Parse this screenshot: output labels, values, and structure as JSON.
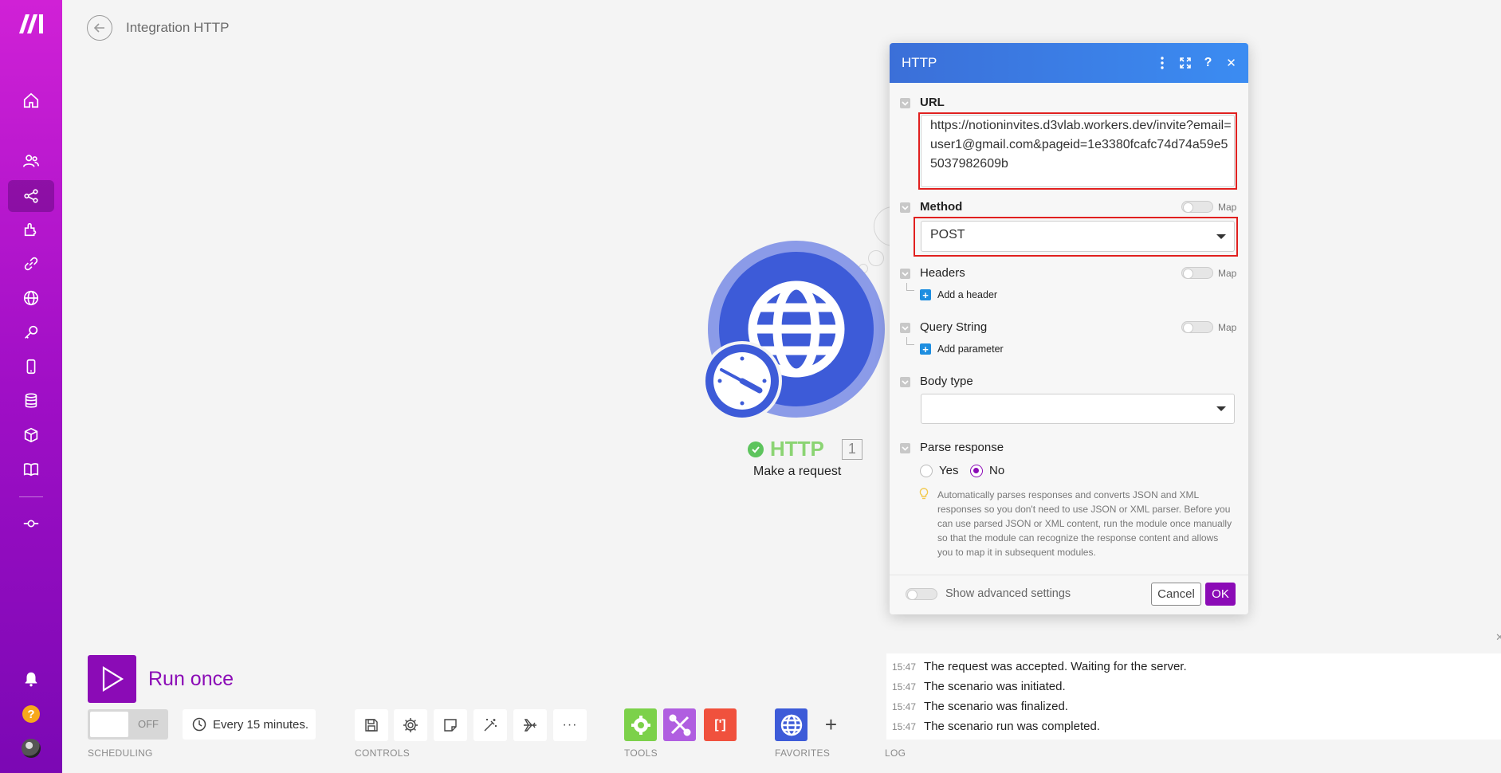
{
  "header": {
    "title": "Integration HTTP"
  },
  "sidebar": {
    "icons": [
      "logo-icon",
      "home-icon",
      "team-icon",
      "scenarios-icon",
      "apps-icon",
      "connections-icon",
      "webhooks-icon",
      "keys-icon",
      "devices-icon",
      "datastores-icon",
      "datastructures-icon",
      "docs-icon",
      "flow-icon",
      "notifications-icon",
      "help-icon",
      "avatar"
    ],
    "active": "scenarios-icon"
  },
  "module": {
    "name": "HTTP",
    "index": "1",
    "subtitle": "Make a request",
    "color": "#3d5bd8"
  },
  "bottom": {
    "run_label": "Run once",
    "toggle_text": "OFF",
    "schedule": "Every 15 minutes.",
    "sections": {
      "scheduling": "SCHEDULING",
      "controls": "CONTROLS",
      "tools": "TOOLS",
      "favorites": "FAVORITES",
      "log": "LOG"
    }
  },
  "log": [
    {
      "time": "15:47",
      "message": "The request was accepted. Waiting for the server."
    },
    {
      "time": "15:47",
      "message": "The scenario was initiated."
    },
    {
      "time": "15:47",
      "message": "The scenario was finalized."
    },
    {
      "time": "15:47",
      "message": "The scenario run was completed."
    }
  ],
  "dialog": {
    "title": "HTTP",
    "url": {
      "label": "URL",
      "value": "https://notioninvites.d3vlab.workers.dev/invite?email=user1@gmail.com&pageid=1e3380fcafc74d74a59e55037982609b"
    },
    "method": {
      "label": "Method",
      "value": "POST",
      "map": "Map"
    },
    "headers": {
      "label": "Headers",
      "add": "Add a header",
      "map": "Map"
    },
    "query": {
      "label": "Query String",
      "add": "Add parameter",
      "map": "Map"
    },
    "body": {
      "label": "Body type",
      "value": ""
    },
    "parse": {
      "label": "Parse response",
      "yes": "Yes",
      "no": "No",
      "selected": "No",
      "hint": "Automatically parses responses and converts JSON and XML responses so you don't need to use JSON or XML parser. Before you can use parsed JSON or XML content, run the module once manually so that the module can recognize the response content and allows you to map it in subsequent modules."
    },
    "advanced": "Show advanced settings",
    "cancel": "Cancel",
    "ok": "OK"
  },
  "colors": {
    "accent": "#8b0bb6",
    "dialog_header": "#3b7ae8",
    "highlight": "#e1201f"
  }
}
